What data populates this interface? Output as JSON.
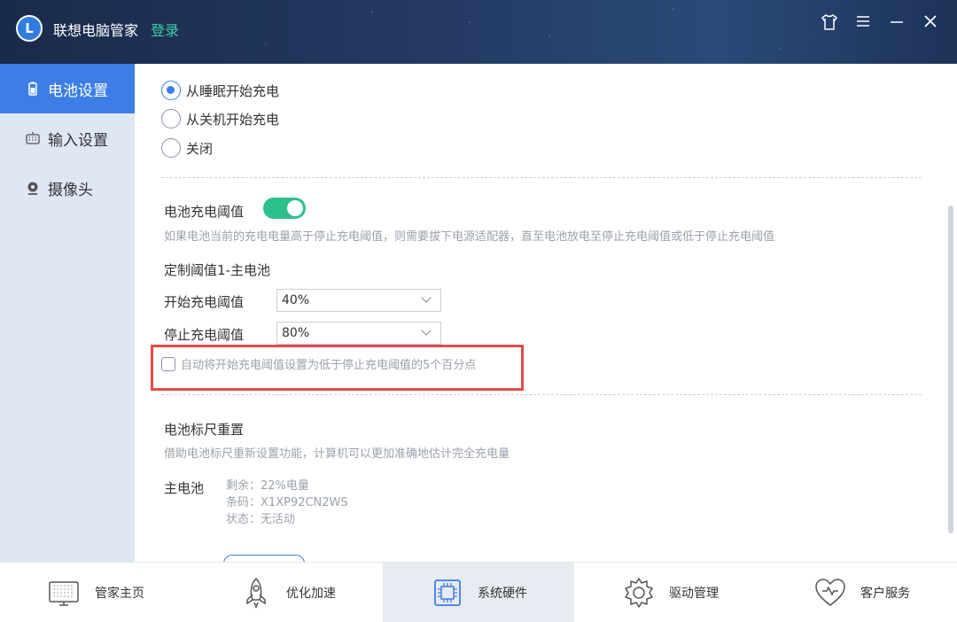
{
  "app": {
    "title": "联想电脑管家",
    "login": "登录",
    "logo_letter": "L"
  },
  "window_controls": [
    "shirt-icon",
    "menu-icon",
    "minimize-icon",
    "close-icon"
  ],
  "sidebar": {
    "items": [
      {
        "label": "电池设置",
        "icon": "battery-icon",
        "active": true
      },
      {
        "label": "输入设置",
        "icon": "keyboard-icon",
        "active": false
      },
      {
        "label": "摄像头",
        "icon": "camera-icon",
        "active": false
      }
    ]
  },
  "charging_mode": {
    "options": [
      {
        "label": "从睡眠开始充电",
        "checked": true
      },
      {
        "label": "从关机开始充电",
        "checked": false
      },
      {
        "label": "关闭",
        "checked": false
      }
    ]
  },
  "threshold": {
    "title": "电池充电阈值",
    "enabled": true,
    "description": "如果电池当前的充电电量高于停止充电阈值，则需要拔下电源适配器，直至电池放电至停止充电阈值或低于停止充电阈值",
    "custom_title": "定制阈值1-主电池",
    "start_label": "开始充电阈值",
    "start_value": "40%",
    "stop_label": "停止充电阈值",
    "stop_value": "80%",
    "auto_checkbox_label": "自动将开始充电阈值设置为低于停止充电阈值的5个百分点",
    "auto_checked": false
  },
  "calibration": {
    "title": "电池标尺重置",
    "description": "借助电池标尺重新设置功能，计算机可以更加准确地估计完全充电量",
    "battery_name": "主电池",
    "remaining": "剩余：22%电量",
    "barcode": "条码：X1XP92CN2WS",
    "status": "状态：无活动"
  },
  "bottom_nav": [
    {
      "label": "管家主页",
      "icon": "monitor-icon",
      "active": false
    },
    {
      "label": "优化加速",
      "icon": "rocket-icon",
      "active": false
    },
    {
      "label": "系统硬件",
      "icon": "chip-icon",
      "active": true
    },
    {
      "label": "驱动管理",
      "icon": "gear-icon",
      "active": false
    },
    {
      "label": "客户服务",
      "icon": "heart-icon",
      "active": false
    }
  ],
  "colors": {
    "accent": "#3d7ee6",
    "toggle_on": "#2cc08a",
    "highlight": "#e34b4b",
    "login": "#3ecfa0"
  }
}
